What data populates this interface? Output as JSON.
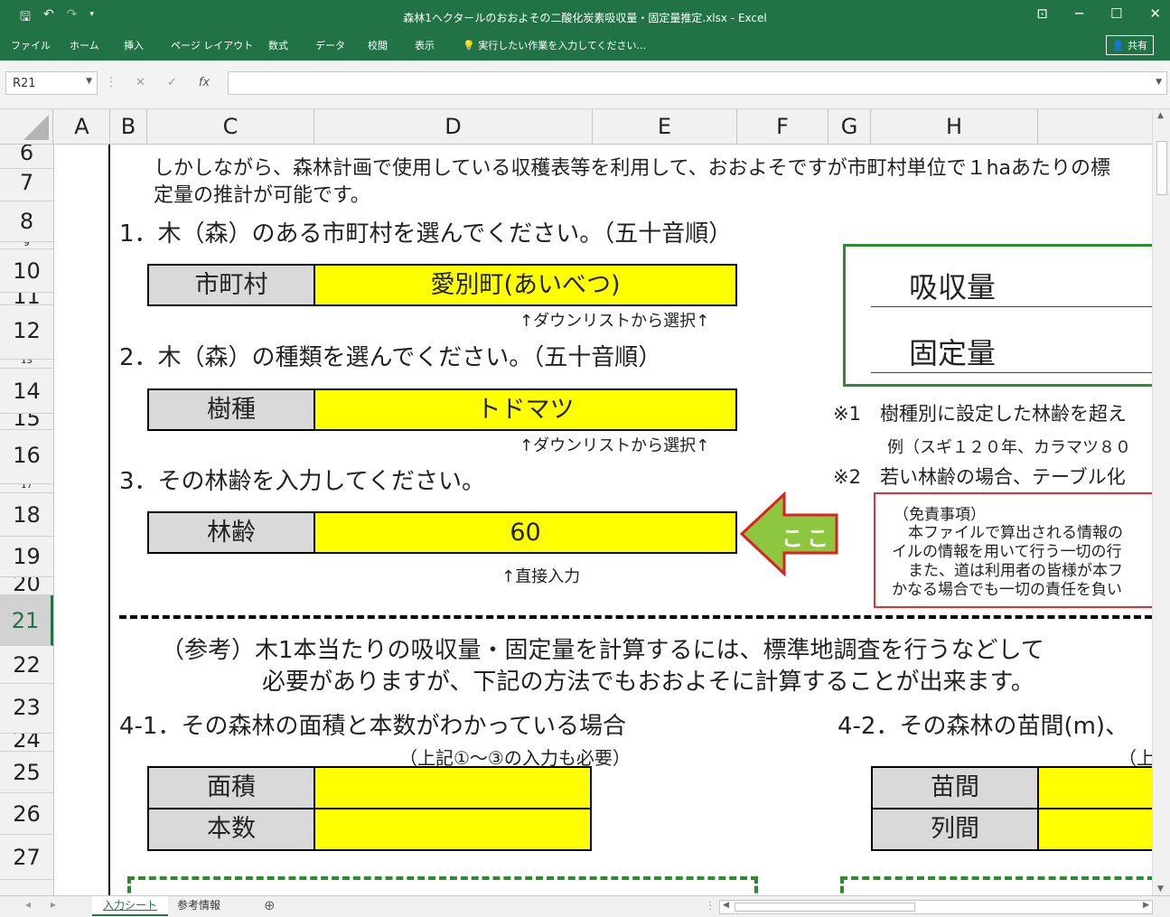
{
  "window": {
    "title": "森林1ヘクタールのおおよその二酸化炭素吸収量・固定量推定.xlsx - Excel",
    "save_icon": "save-icon",
    "undo_icon": "undo-icon",
    "redo_icon": "redo-icon",
    "min": "─",
    "max": "☐",
    "close": "✕",
    "ribbon_opts": "⊡"
  },
  "ribbon": {
    "tabs": [
      "ファイル",
      "ホーム",
      "挿入",
      "ページ レイアウト",
      "数式",
      "データ",
      "校閲",
      "表示"
    ],
    "tell_me": "実行したい作業を入力してください...",
    "share": "共有"
  },
  "formula_bar": {
    "name_box": "R21",
    "cancel": "✕",
    "enter": "✓",
    "fx": "fx",
    "content": ""
  },
  "columns": [
    "A",
    "B",
    "C",
    "D",
    "E",
    "F",
    "G",
    "H"
  ],
  "rows": [
    "6",
    "7",
    "8",
    "9",
    "10",
    "11",
    "12",
    "13",
    "14",
    "15",
    "16",
    "17",
    "18",
    "19",
    "20",
    "21",
    "22",
    "23",
    "24",
    "25",
    "26",
    "27"
  ],
  "selected_row": "21",
  "content": {
    "intro_line1": "しかしながら、森林計画で使用している収穫表等を利用して、おおよそですが市町村単位で１haあたりの標",
    "intro_line2": "定量の推計が可能です。",
    "step1": "1．木（森）のある市町村を選んでください。（五十音順）",
    "municipality_label": "市町村",
    "municipality_value": "愛別町(あいべつ)",
    "dropdown_note1": "↑ダウンリストから選択↑",
    "step2": "2．木（森）の種類を選んでください。（五十音順）",
    "species_label": "樹種",
    "species_value": "トドマツ",
    "dropdown_note2": "↑ダウンリストから選択↑",
    "step3": "3．その林齢を入力してください。",
    "age_label": "林齢",
    "age_value": "60",
    "direct_input_note": "↑直接入力",
    "arrow_text": "ここ",
    "absorption_label": "吸収量",
    "fixed_label": "固定量",
    "note1": "※1　樹種別に設定した林齢を超え",
    "note1_example": "例（スギ１２０年、カラマツ８０",
    "note2": "※2　若い林齢の場合、テーブル化",
    "disclaimer_title": "（免責事項）",
    "disclaimer_1": "本ファイルで算出される情報の",
    "disclaimer_2": "イルの情報を用いて行う一切の行",
    "disclaimer_3": "また、道は利用者の皆様が本フ",
    "disclaimer_4": "かなる場合でも一切の責任を負い",
    "ref_line1": "（参考）木1本当たりの吸収量・固定量を計算するには、標準地調査を行うなどして",
    "ref_line2": "必要がありますが、下記の方法でもおおよそに計算することが出来ます。",
    "step4_1": "4-1．その森林の面積と本数がわかっている場合",
    "step4_1_note": "（上記①～③の入力も必要）",
    "area_label": "面積",
    "count_label": "本数",
    "area_value": "",
    "count_value": "",
    "step4_2": "4-2．その森林の苗間(m)、",
    "step4_2_note": "（上",
    "spacing_label": "苗間",
    "row_spacing_label": "列間",
    "spacing_value": "",
    "row_spacing_value": ""
  },
  "sheet_tabs": {
    "tabs": [
      "入力シート",
      "参考情報"
    ],
    "active": "入力シート",
    "add": "⊕",
    "prev": "◂",
    "next": "▸"
  },
  "colors": {
    "accent": "#217346",
    "yellow": "#ffff00",
    "label_gray": "#d9d9d9",
    "green_box": "#2e8b2e",
    "arrow_fill": "#8dc63f",
    "arrow_border": "#e02020",
    "disclaimer_border": "#e03030"
  }
}
